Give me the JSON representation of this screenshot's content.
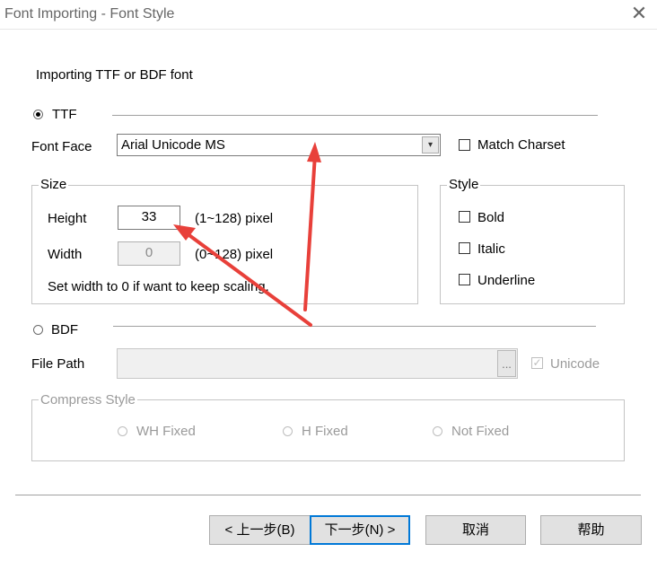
{
  "window": {
    "title": "Font Importing - Font Style",
    "close_glyph": "✕"
  },
  "intro": "Importing TTF or BDF font",
  "ttf": {
    "label": "TTF",
    "selected": true
  },
  "font_face": {
    "label": "Font Face",
    "value": "Arial Unicode MS",
    "arrow": "▾"
  },
  "match_charset": {
    "label": "Match Charset",
    "checked": false
  },
  "size": {
    "legend": "Size",
    "height_label": "Height",
    "height_value": "33",
    "height_range": "(1~128) pixel",
    "width_label": "Width",
    "width_value": "0",
    "width_range": "(0~128) pixel",
    "note": "Set width to 0 if want to keep scaling."
  },
  "style": {
    "legend": "Style",
    "bold": "Bold",
    "italic": "Italic",
    "underline": "Underline"
  },
  "bdf": {
    "label": "BDF",
    "selected": false
  },
  "file_path": {
    "label": "File Path",
    "value": "",
    "browse": "..."
  },
  "unicode": {
    "label": "Unicode",
    "checked": true,
    "check_glyph": "✓"
  },
  "compress": {
    "legend": "Compress Style",
    "wh_fixed": "WH Fixed",
    "h_fixed": "H Fixed",
    "not_fixed": "Not Fixed"
  },
  "buttons": {
    "back": "< 上一步(B)",
    "next": "下一步(N) >",
    "cancel": "取消",
    "help": "帮助"
  },
  "colors": {
    "arrow": "#e8403a",
    "default_button_border": "#0078d7"
  }
}
